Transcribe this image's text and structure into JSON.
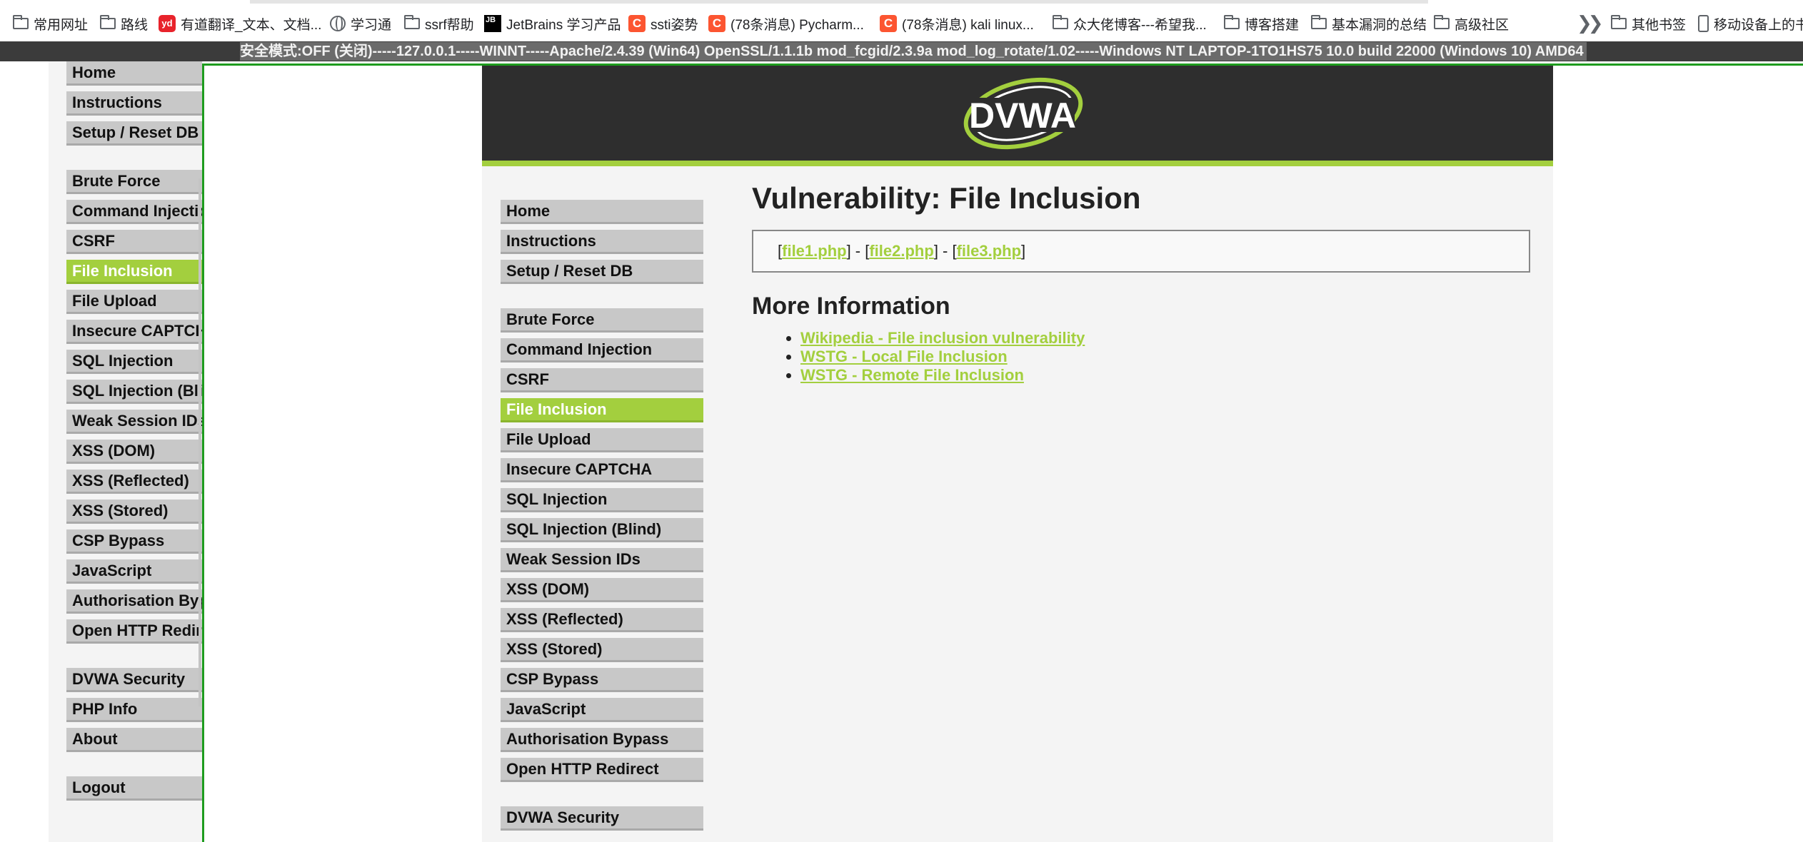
{
  "bookmarks": {
    "items": [
      {
        "label": "常用网址",
        "icon": "folder-icon"
      },
      {
        "label": "路线",
        "icon": "folder-icon"
      },
      {
        "label": "有道翻译_文本、文档...",
        "icon": "youdao-icon"
      },
      {
        "label": "学习通",
        "icon": "globe-icon"
      },
      {
        "label": "ssrf帮助",
        "icon": "folder-icon"
      },
      {
        "label": "JetBrains 学习产品",
        "icon": "jetbrains-icon"
      },
      {
        "label": "ssti姿势",
        "icon": "csdn-icon"
      },
      {
        "label": "(78条消息) Pycharm...",
        "icon": "csdn-icon"
      },
      {
        "label": "(78条消息) kali linux...",
        "icon": "csdn-icon"
      },
      {
        "label": "众大佬博客---希望我...",
        "icon": "folder-icon"
      },
      {
        "label": "博客搭建",
        "icon": "folder-icon"
      },
      {
        "label": "基本漏洞的总结",
        "icon": "folder-icon"
      },
      {
        "label": "高级社区",
        "icon": "folder-icon"
      }
    ],
    "other_bookmarks": "其他书签",
    "mobile_bookmarks": "移动设备上的书"
  },
  "hackbar": {
    "text": "安全模式:OFF (关闭)-----127.0.0.1-----WINNT-----Apache/2.4.39 (Win64) OpenSSL/1.1.1b mod_fcgid/2.3.9a mod_log_rotate/1.02-----Windows NT LAPTOP-1TO1HS75 10.0 build 22000 (Windows 10) AMD64"
  },
  "menu": {
    "top": [
      "Home",
      "Instructions",
      "Setup / Reset DB"
    ],
    "vulns": [
      "Brute Force",
      "Command Injection",
      "CSRF",
      "File Inclusion",
      "File Upload",
      "Insecure CAPTCHA",
      "SQL Injection",
      "SQL Injection (Blind)",
      "Weak Session IDs",
      "XSS (DOM)",
      "XSS (Reflected)",
      "XSS (Stored)",
      "CSP Bypass",
      "JavaScript",
      "Authorisation Bypass",
      "Open HTTP Redirect"
    ],
    "settings": [
      "DVWA Security",
      "PHP Info",
      "About"
    ],
    "logout": "Logout",
    "active": "File Inclusion"
  },
  "logo_text": "DVWA",
  "page": {
    "title": "Vulnerability: File Inclusion",
    "files": [
      "file1.php",
      "file2.php",
      "file3.php"
    ],
    "more_info_heading": "More Information",
    "links": [
      "Wikipedia - File inclusion vulnerability",
      "WSTG - Local File Inclusion",
      "WSTG - Remote File Inclusion"
    ]
  },
  "colors": {
    "accent": "#a3cf3e",
    "header": "#2e2e2e",
    "frame_border": "#1e9c1e"
  }
}
